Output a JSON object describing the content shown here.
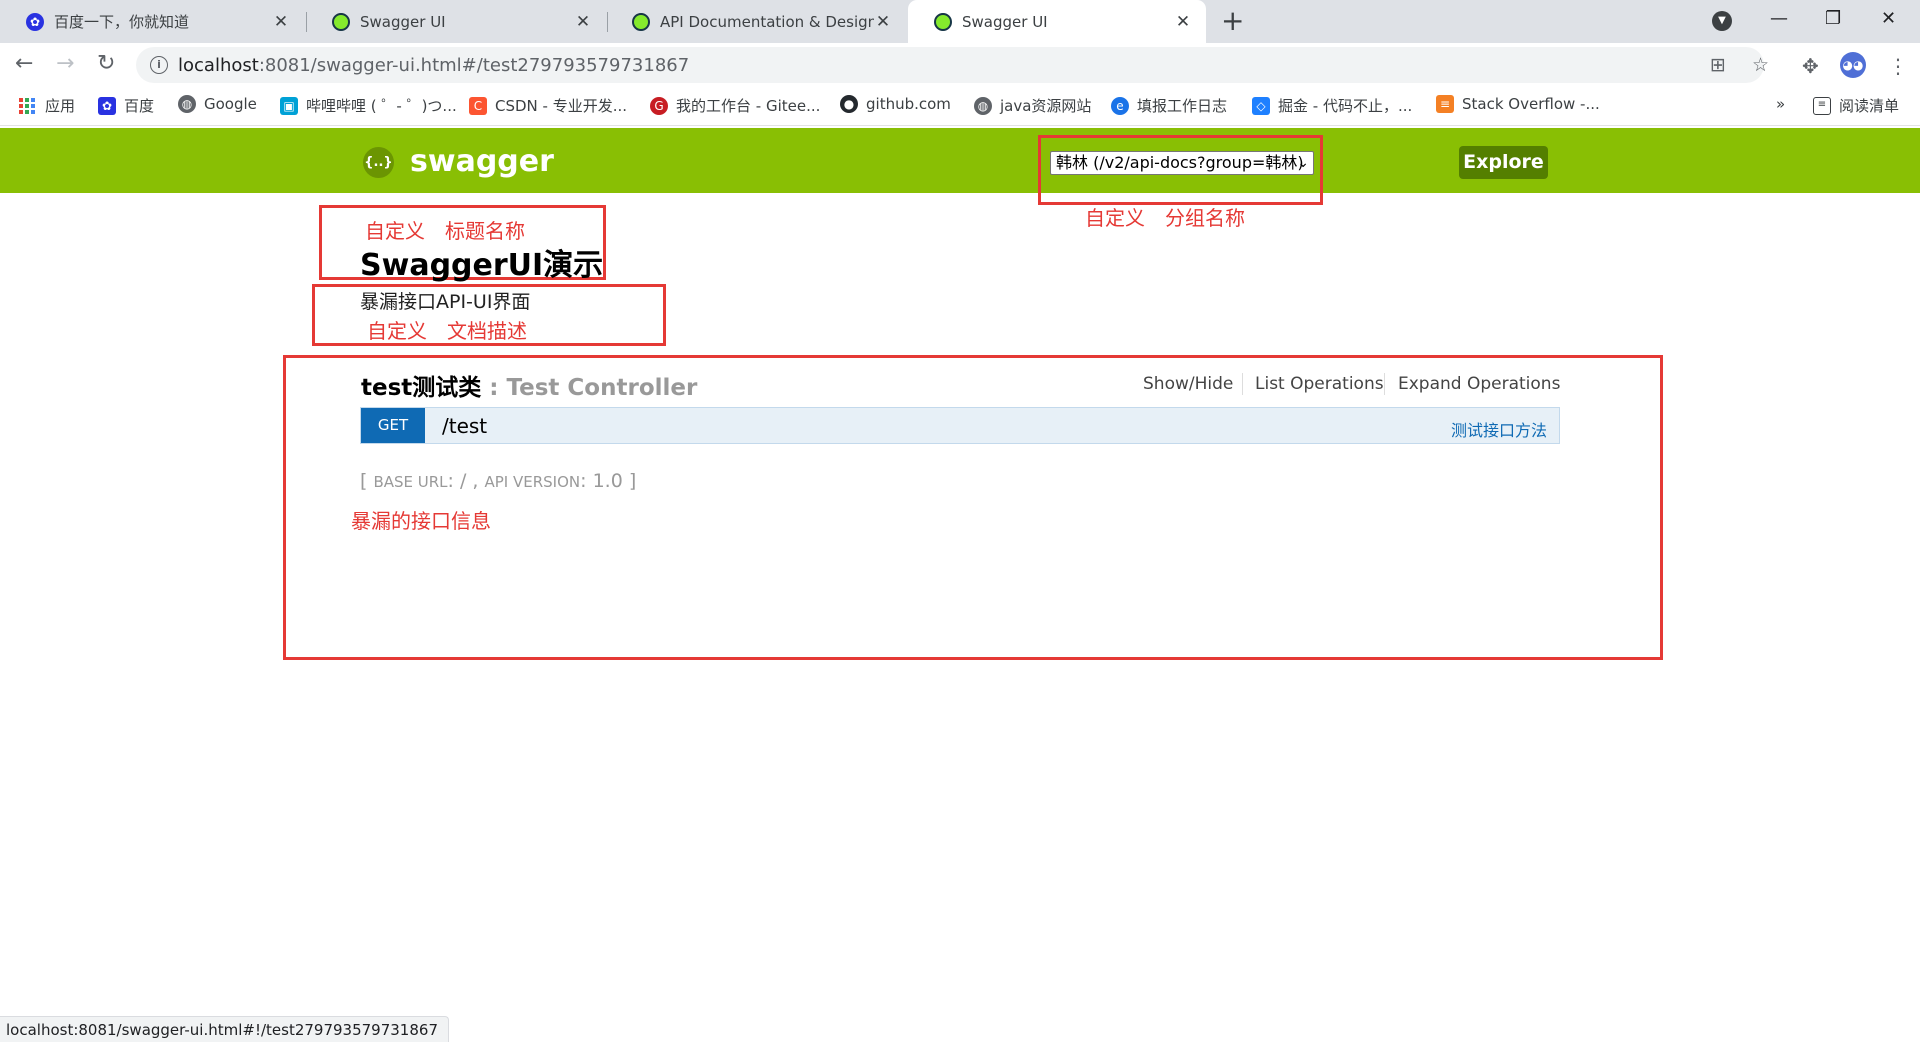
{
  "browser": {
    "tabs": [
      {
        "title": "百度一下，你就知道",
        "icon": "baidu-favicon",
        "active": false
      },
      {
        "title": "Swagger UI",
        "icon": "swagger-favicon",
        "active": false
      },
      {
        "title": "API Documentation & Design",
        "icon": "swagger-favicon",
        "active": false
      },
      {
        "title": "Swagger UI",
        "icon": "swagger-favicon",
        "active": true
      }
    ],
    "url_host": "localhost",
    "url_rest": ":8081/swagger-ui.html#/test279793579731867",
    "bookmarks": [
      {
        "label": "应用",
        "icon": "apps-grid-icon"
      },
      {
        "label": "百度",
        "icon": "baidu-icon",
        "color": "#2932e1"
      },
      {
        "label": "Google",
        "icon": "globe-icon",
        "color": "#5f6368"
      },
      {
        "label": "哔哩哔哩 ( ゜- ゜)つ...",
        "icon": "bilibili-icon",
        "color": "#00a1d6"
      },
      {
        "label": "CSDN - 专业开发...",
        "icon": "csdn-icon",
        "color": "#fc5531"
      },
      {
        "label": "我的工作台 - Gitee...",
        "icon": "gitee-icon",
        "color": "#c71d23"
      },
      {
        "label": "github.com",
        "icon": "github-icon",
        "color": "#24292e"
      },
      {
        "label": "java资源网站",
        "icon": "globe-icon",
        "color": "#5f6368"
      },
      {
        "label": "填报工作日志",
        "icon": "worklog-icon",
        "color": "#1a73e8"
      },
      {
        "label": "掘金 - 代码不止，...",
        "icon": "juejin-icon",
        "color": "#1e80ff"
      },
      {
        "label": "Stack Overflow -...",
        "icon": "stackoverflow-icon",
        "color": "#f48024"
      }
    ],
    "more_bookmarks": "»",
    "reading_list": "阅读清单",
    "status_url": "localhost:8081/swagger-ui.html#!/test279793579731867"
  },
  "swagger": {
    "logo_text": "swagger",
    "logo_glyph": "{..}",
    "group_select": "韩林 (/v2/api-docs?group=韩林)",
    "explore_label": "Explore",
    "title": "SwaggerUI演示",
    "description": "暴漏接口API-UI界面",
    "controller": {
      "name": "test测试类",
      "separator": " : ",
      "desc": "Test Controller",
      "links": [
        "Show/Hide",
        "List Operations",
        "Expand Operations"
      ]
    },
    "operation": {
      "method": "GET",
      "path": "/test",
      "summary": "测试接口方法"
    },
    "base_info": {
      "open": "[ ",
      "base_url_label": "BASE URL",
      "base_url_value": ": / , ",
      "api_version_label": "API VERSION",
      "api_version_value": ": 1.0",
      "close": " ]"
    }
  },
  "annotations": {
    "title_note": "自定义　标题名称",
    "group_note": "自定义　分组名称",
    "desc_note": "自定义　文档描述",
    "api_note": "暴漏的接口信息",
    "color": "#e53935"
  },
  "colors": {
    "swagger_green": "#89bf04",
    "explore_bg": "#547f00",
    "get_blue": "#0f6ab4"
  }
}
